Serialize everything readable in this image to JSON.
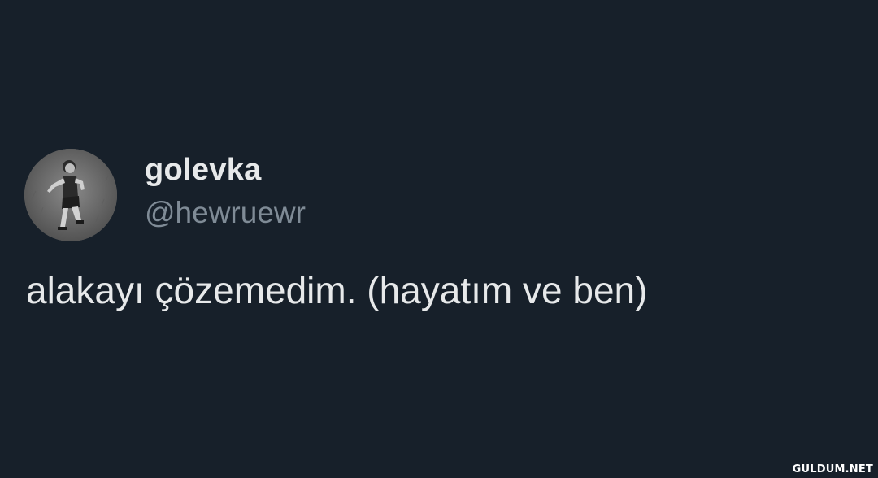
{
  "tweet": {
    "display_name": "golevka",
    "handle": "@hewruewr",
    "text": "alakayı çözemedim. (hayatım ve ben)"
  },
  "watermark": {
    "text": "GULDUM.NET"
  },
  "colors": {
    "background": "#17202a",
    "primary_text": "#e7e9ea",
    "secondary_text": "#7f8b96"
  }
}
